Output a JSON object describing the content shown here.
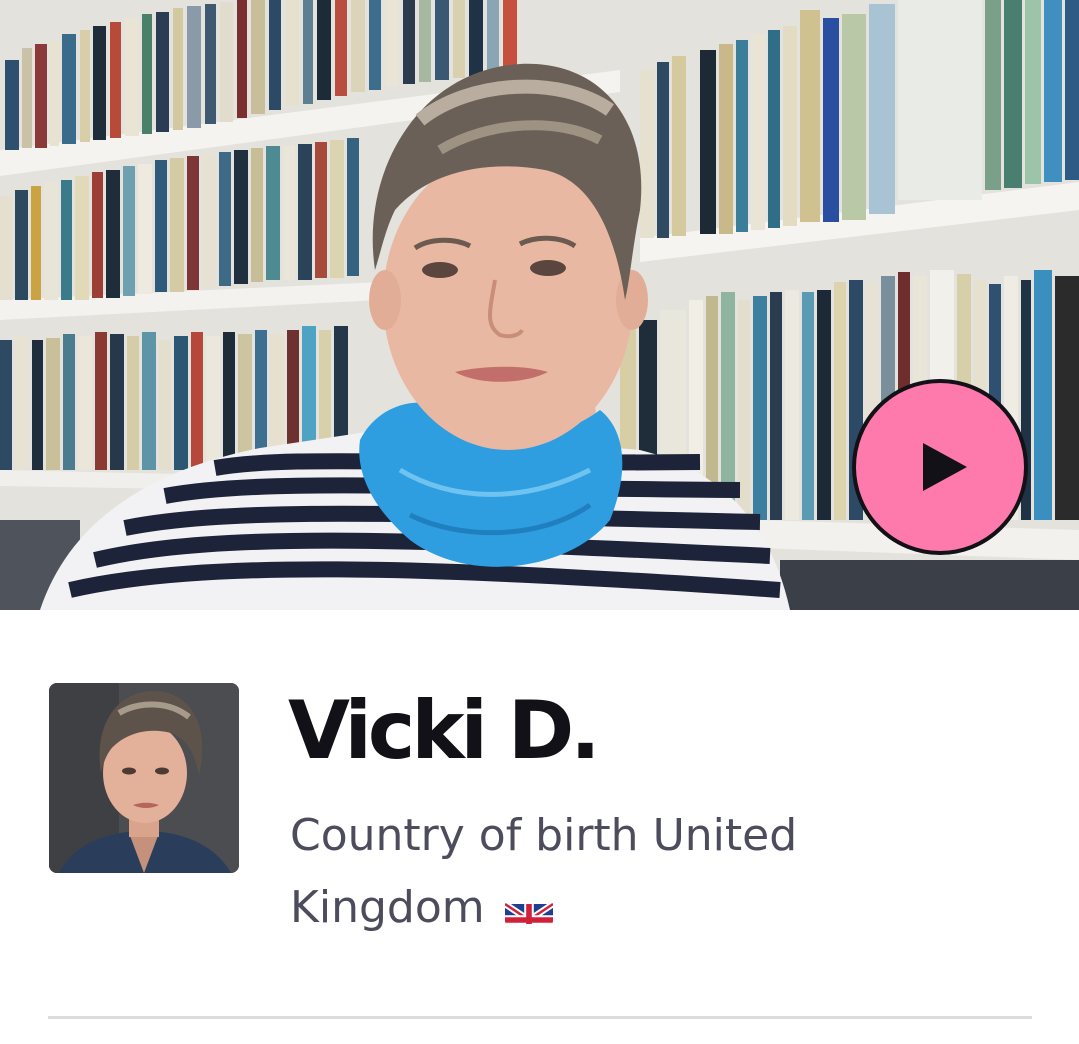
{
  "tutor": {
    "name": "Vicki D.",
    "country_label": "Country of birth",
    "country": "United Kingdom",
    "flag_icon": "uk-flag-icon"
  },
  "video": {
    "play_icon": "play-icon",
    "play_button_color": "#ff7aac"
  },
  "colors": {
    "text_primary": "#121117",
    "text_secondary": "#4d4c5c",
    "divider": "#dcdcde"
  }
}
